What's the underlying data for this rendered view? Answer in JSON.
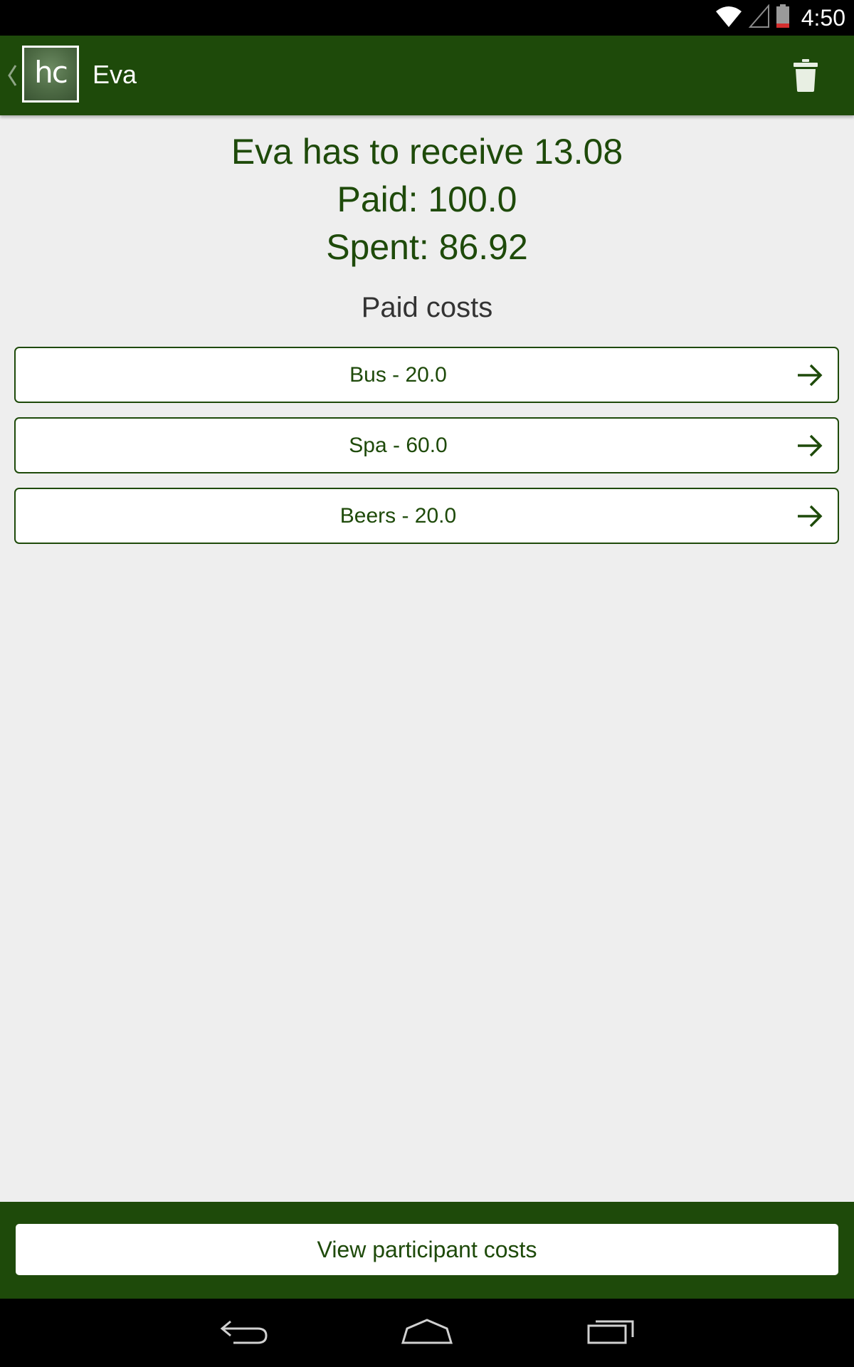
{
  "status_bar": {
    "time": "4:50",
    "icons": [
      "wifi-icon",
      "cell-signal-icon",
      "battery-icon"
    ]
  },
  "action_bar": {
    "logo_text": "hc",
    "title": "Eva",
    "actions": [
      "delete-icon"
    ]
  },
  "summary": {
    "balance_line": "Eva has to receive 13.08",
    "paid_line": "Paid: 100.0",
    "spent_line": "Spent: 86.92"
  },
  "paid_costs": {
    "title": "Paid costs",
    "items": [
      {
        "label": "Bus - 20.0"
      },
      {
        "label": "Spa - 60.0"
      },
      {
        "label": "Beers - 20.0"
      }
    ]
  },
  "bottom": {
    "view_button_label": "View participant costs"
  },
  "nav_bar": {
    "buttons": [
      "back-icon",
      "home-icon",
      "recents-icon"
    ]
  },
  "colors": {
    "primary": "#1e4a0a",
    "background": "#eeeeee",
    "card": "#ffffff"
  }
}
